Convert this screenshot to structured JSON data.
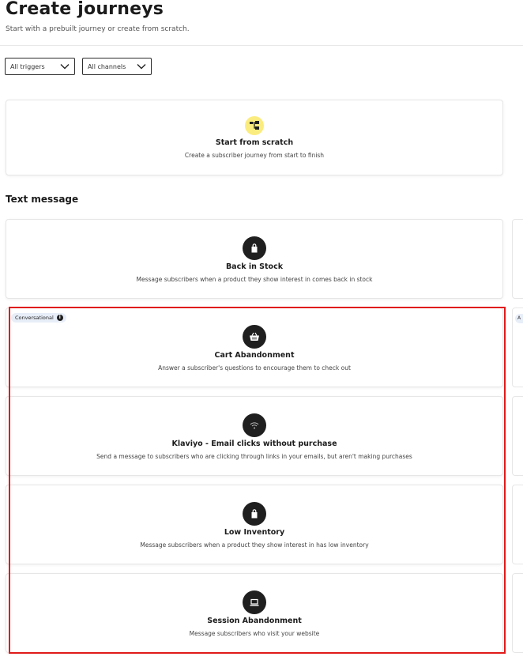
{
  "header": {
    "title": "Create journeys",
    "subtitle": "Start with a prebuilt journey or create from scratch."
  },
  "filters": {
    "triggers": "All triggers",
    "channels": "All channels"
  },
  "scratch_card": {
    "icon": "flow-icon",
    "title": "Start from scratch",
    "description": "Create a subscriber journey from start to finish"
  },
  "section": {
    "title": "Text message"
  },
  "cards": [
    {
      "icon": "shopping-bag-icon",
      "title": "Back in Stock",
      "description": "Message subscribers when a product they show interest in comes back in stock"
    },
    {
      "badge": "Conversational",
      "icon": "shopping-basket-icon",
      "title": "Cart Abandonment",
      "description": "Answer a subscriber's questions to encourage them to check out"
    },
    {
      "icon": "email-signal-icon",
      "title": "Klaviyo - Email clicks without purchase",
      "description": "Send a message to subscribers who are clicking through links in your emails, but aren't making purchases"
    },
    {
      "icon": "shopping-bag-icon",
      "title": "Low Inventory",
      "description": "Message subscribers when a product they show interest in has low inventory"
    },
    {
      "icon": "laptop-icon",
      "title": "Session Abandonment",
      "description": "Message subscribers who visit your website"
    }
  ],
  "peek_badge": "A",
  "colors": {
    "highlight": "#e01a1a",
    "scratch_icon_bg": "#fbec7f",
    "dark_icon_bg": "#1f1f1f",
    "badge_bg": "#e8eef8"
  }
}
